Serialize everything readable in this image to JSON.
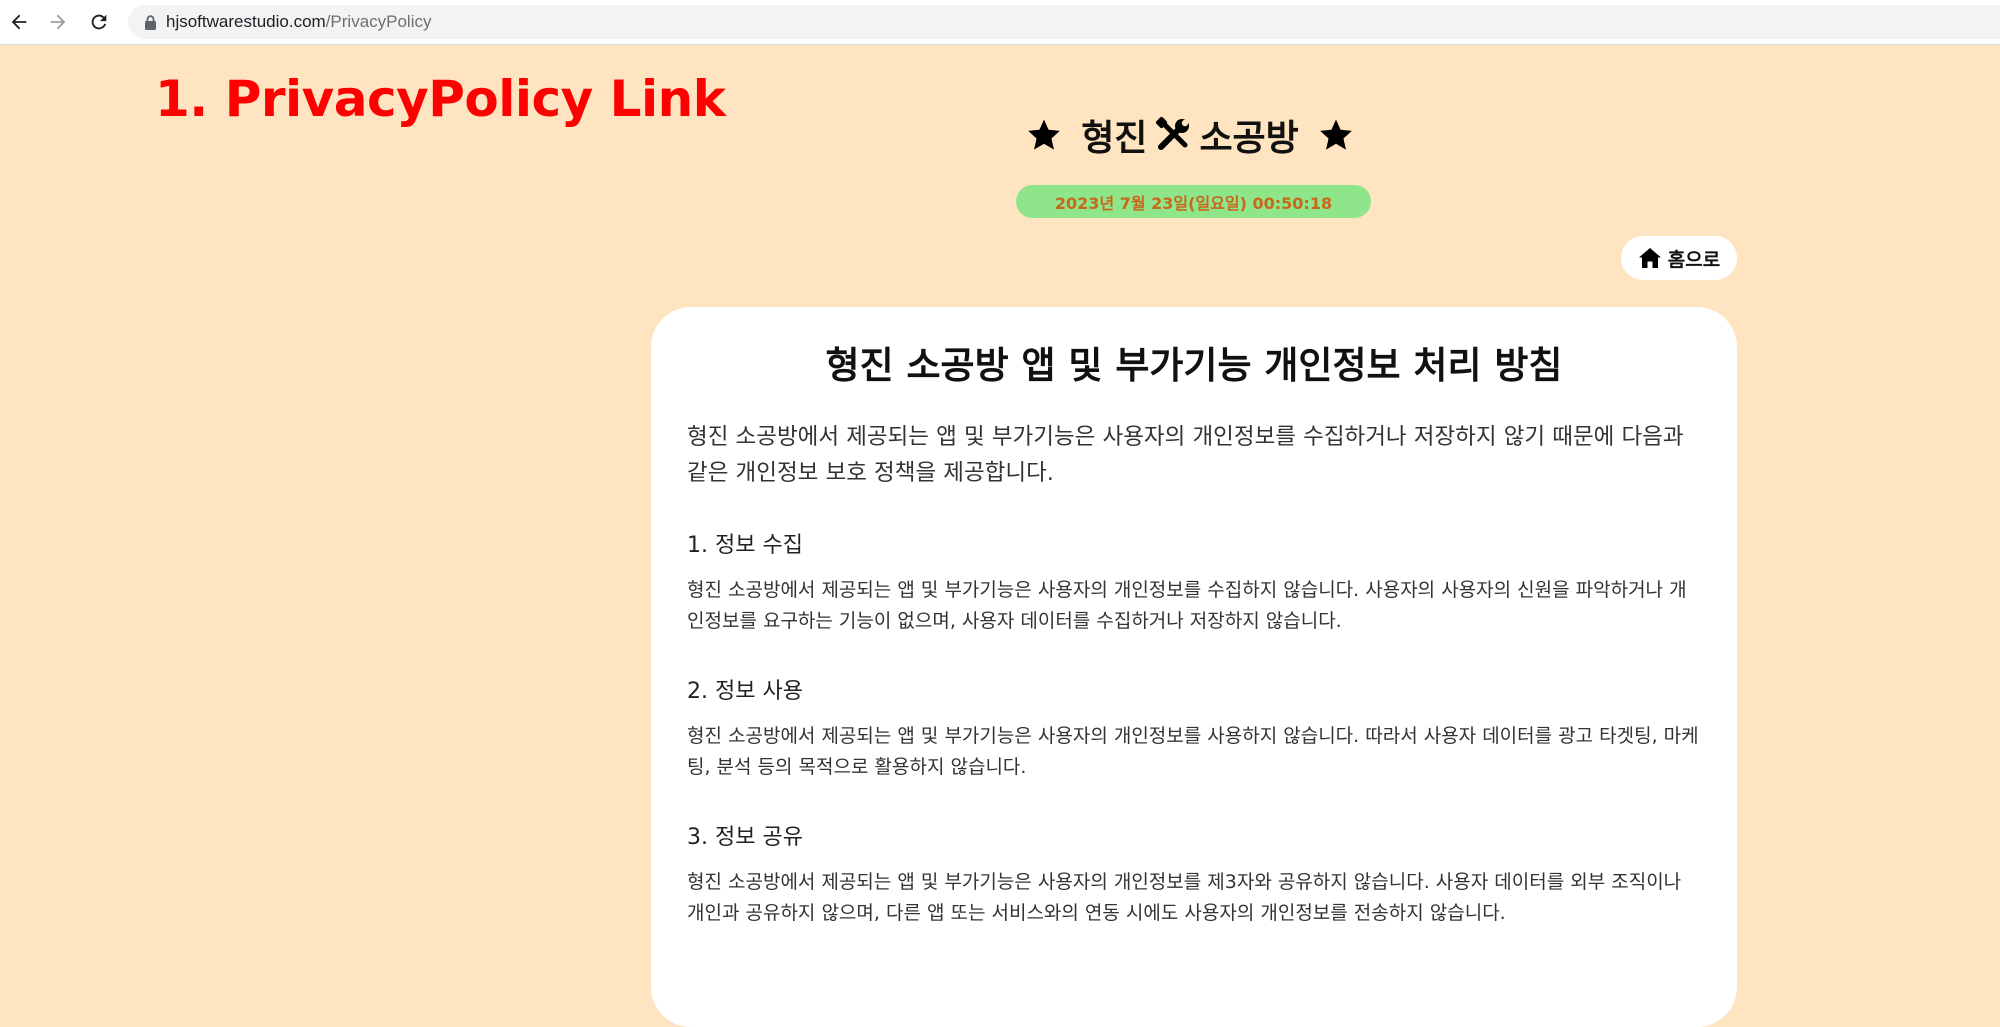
{
  "browser": {
    "url_domain": "hjsoftwarestudio.com",
    "url_path": "/PrivacyPolicy"
  },
  "annotation": {
    "text": "1. PrivacyPolicy Link",
    "color": "#ff0000"
  },
  "header": {
    "title_left": "형진",
    "title_right": "소공방",
    "date_text": "2023년 7월 23일(일요일) 00:50:18",
    "home_label": "홈으로"
  },
  "colors": {
    "page_background": "#ffe4c1",
    "date_pill_background": "#8ee58a",
    "date_text": "#c8681a"
  },
  "policy": {
    "title": "형진 소공방 앱 및 부가기능 개인정보 처리 방침",
    "intro": "형진 소공방에서 제공되는 앱 및 부가기능은 사용자의 개인정보를 수집하거나 저장하지 않기 때문에 다음과 같은 개인정보 보호 정책을 제공합니다.",
    "sections": [
      {
        "heading": "1. 정보 수집",
        "body": "형진 소공방에서 제공되는 앱 및 부가기능은 사용자의 개인정보를 수집하지 않습니다. 사용자의 사용자의 신원을 파악하거나 개인정보를 요구하는 기능이 없으며, 사용자 데이터를 수집하거나 저장하지 않습니다."
      },
      {
        "heading": "2. 정보 사용",
        "body": "형진 소공방에서 제공되는 앱 및 부가기능은 사용자의 개인정보를 사용하지 않습니다. 따라서 사용자 데이터를 광고 타겟팅, 마케팅, 분석 등의 목적으로 활용하지 않습니다."
      },
      {
        "heading": "3. 정보 공유",
        "body": "형진 소공방에서 제공되는 앱 및 부가기능은 사용자의 개인정보를 제3자와 공유하지 않습니다. 사용자 데이터를 외부 조직이나 개인과 공유하지 않으며, 다른 앱 또는 서비스와의 연동 시에도 사용자의 개인정보를 전송하지 않습니다."
      }
    ]
  }
}
